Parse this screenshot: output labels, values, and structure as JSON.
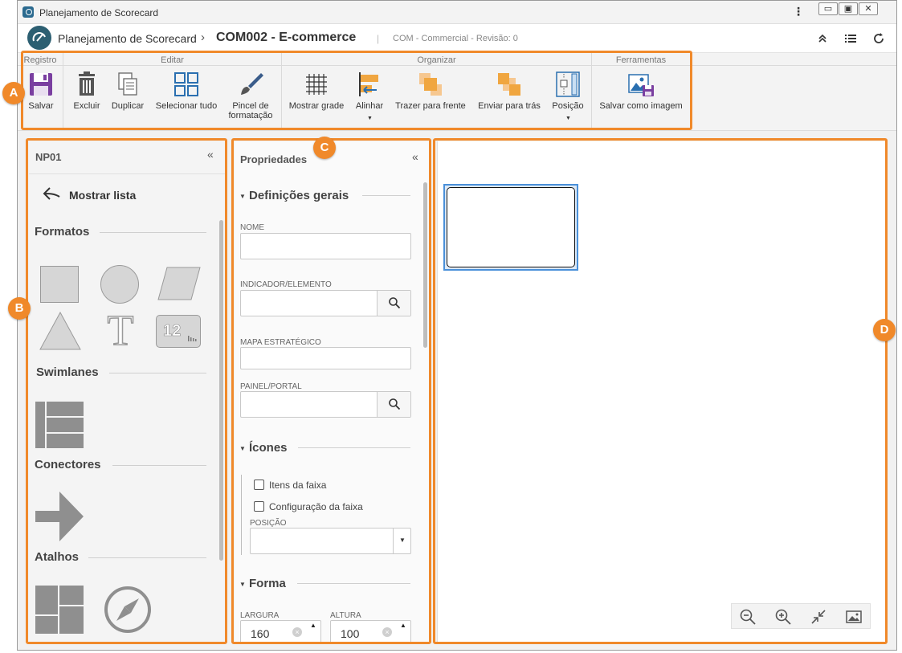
{
  "window": {
    "title": "Planejamento de Scorecard",
    "controls": [
      "minimize-icon",
      "restore-icon",
      "close-icon"
    ]
  },
  "header": {
    "app": "Planejamento de Scorecard",
    "separator": "›",
    "title": "COM002 - E-commerce",
    "divider": "|",
    "info": "COM - Commercial - Revisão: 0",
    "icons": [
      "collapse-up-icon",
      "list-icon",
      "refresh-icon"
    ]
  },
  "toolbar": {
    "groups": {
      "registro": "Registro",
      "editar": "Editar",
      "organizar": "Organizar",
      "ferramentas": "Ferramentas"
    },
    "buttons": {
      "salvar": "Salvar",
      "excluir": "Excluir",
      "duplicar": "Duplicar",
      "selecionar": "Selecionar tudo",
      "pincel": "Pincel de formatação",
      "grade": "Mostrar grade",
      "alinhar": "Alinhar",
      "frente": "Trazer para frente",
      "tras": "Enviar para trás",
      "posicao": "Posição",
      "imagem": "Salvar como imagem"
    },
    "caret": "▼"
  },
  "panelB": {
    "title": "NP01",
    "collapse": "«",
    "back": "Mostrar lista",
    "sections": {
      "formatos": "Formatos",
      "swimlanes": "Swimlanes",
      "conectores": "Conectores",
      "atalhos": "Atalhos"
    },
    "text_shape": "T",
    "number_shape": "12"
  },
  "panelC": {
    "title": "Propriedades",
    "collapse": "«",
    "sections": {
      "gerais": "Definições gerais",
      "icones": "Ícones",
      "forma": "Forma"
    },
    "fields": {
      "nome": "NOME",
      "indicador": "INDICADOR/ELEMENTO",
      "mapa": "MAPA ESTRATÉGICO",
      "painel": "PAINEL/PORTAL",
      "posicao": "POSIÇÃO",
      "largura": "LARGURA",
      "altura": "ALTURA"
    },
    "checkboxes": {
      "itens": "Itens da faixa",
      "config": "Configuração da faixa"
    },
    "values": {
      "largura": "160",
      "altura": "100"
    }
  },
  "annotations": {
    "a": "A",
    "b": "B",
    "c": "C",
    "d": "D"
  },
  "colors": {
    "accent": "#f0892a",
    "selection": "#4a90d9",
    "logo": "#2c5f72"
  }
}
